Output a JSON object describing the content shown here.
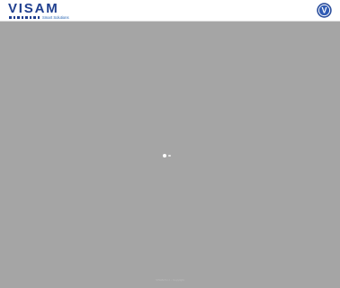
{
  "header": {
    "logo_text": "VISAM",
    "logo_tagline": "Smart Solutions",
    "badge_letter": "V"
  },
  "footer": {
    "text": "VISAM S.r.l. - Copyright"
  },
  "colors": {
    "brand": "#1f3f8f",
    "background": "#a5a5a5"
  },
  "icons": [
    "visam-logo",
    "visam-badge-icon",
    "loading-spinner-icon"
  ]
}
